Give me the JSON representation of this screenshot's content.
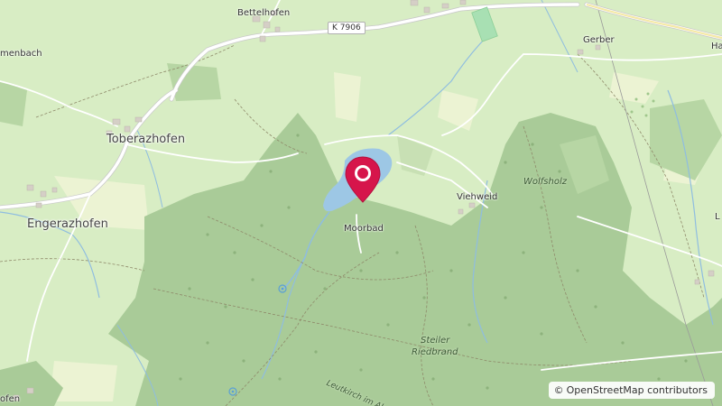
{
  "map": {
    "places": {
      "bettelhofen": "Bettelhofen",
      "toberazhofen": "Toberazhofen",
      "engerazhofen": "Engerazhofen",
      "gerber": "Gerber",
      "viehweid": "Viehweid",
      "moorbad": "Moorbad",
      "wolfsholz": "Wolfsholz",
      "steiler_riedbrand_1": "Steiler",
      "steiler_riedbrand_2": "Riedbrand",
      "menbach": "menbach",
      "ha": "Ha",
      "l": "L",
      "ofen": "ofen",
      "road_leutkirch": "Leutkirch im Al"
    },
    "road_ref": "K 7906",
    "attribution": "OpenStreetMap contributors",
    "attribution_symbol": "©",
    "marker": {
      "icon": "location-pin-icon",
      "color": "#d6154b"
    },
    "colors": {
      "meadow": "#d7ecc2",
      "forest": "#a9cb98",
      "water": "#9dc7e5",
      "road": "#ffffff"
    }
  }
}
